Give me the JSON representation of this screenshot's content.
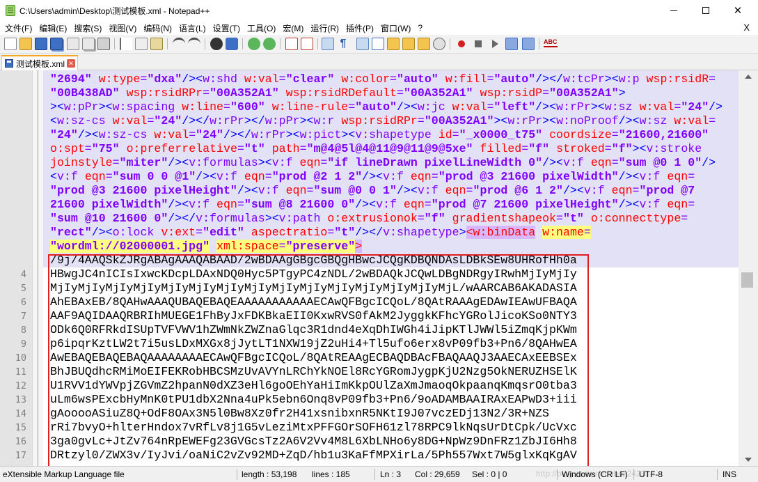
{
  "window": {
    "title": "C:\\Users\\admin\\Desktop\\测试模板.xml - Notepad++"
  },
  "menu": [
    "文件(F)",
    "编辑(E)",
    "搜索(S)",
    "视图(V)",
    "编码(N)",
    "语言(L)",
    "设置(T)",
    "工具(O)",
    "宏(M)",
    "运行(R)",
    "插件(P)",
    "窗口(W)",
    "?"
  ],
  "menu_close": "X",
  "tab": {
    "label": "测试模板.xml"
  },
  "toolbar": {
    "spellcheck_label": "ABC"
  },
  "editor": {
    "line_numbers": [
      "4",
      "5",
      "6",
      "7",
      "8",
      "9",
      "10",
      "11",
      "12",
      "13",
      "14",
      "15",
      "16",
      "17"
    ],
    "wrapped_lines": [
      [
        {
          "c": "v",
          "t": "\"2694\""
        },
        {
          "c": "t",
          "t": " "
        },
        {
          "c": "a",
          "t": "w:type"
        },
        {
          "c": "t",
          "t": "="
        },
        {
          "c": "v",
          "t": "\"dxa\""
        },
        {
          "c": "sep",
          "t": "/><"
        },
        {
          "c": "t",
          "t": "w:shd "
        },
        {
          "c": "a",
          "t": "w:val"
        },
        {
          "c": "t",
          "t": "="
        },
        {
          "c": "v",
          "t": "\"clear\""
        },
        {
          "c": "t",
          "t": " "
        },
        {
          "c": "a",
          "t": "w:color"
        },
        {
          "c": "t",
          "t": "="
        },
        {
          "c": "v",
          "t": "\"auto\""
        },
        {
          "c": "t",
          "t": " "
        },
        {
          "c": "a",
          "t": "w:fill"
        },
        {
          "c": "t",
          "t": "="
        },
        {
          "c": "v",
          "t": "\"auto\""
        },
        {
          "c": "sep",
          "t": "/></"
        },
        {
          "c": "t",
          "t": "w:tcPr"
        },
        {
          "c": "sep",
          "t": "><"
        },
        {
          "c": "t",
          "t": "w:p "
        },
        {
          "c": "a",
          "t": "wsp:rsidR"
        },
        {
          "c": "t",
          "t": "="
        }
      ],
      [
        {
          "c": "v",
          "t": "\"00B438AD\""
        },
        {
          "c": "t",
          "t": " "
        },
        {
          "c": "a",
          "t": "wsp:rsidRPr"
        },
        {
          "c": "t",
          "t": "="
        },
        {
          "c": "v",
          "t": "\"00A352A1\""
        },
        {
          "c": "t",
          "t": " "
        },
        {
          "c": "a",
          "t": "wsp:rsidRDefault"
        },
        {
          "c": "t",
          "t": "="
        },
        {
          "c": "v",
          "t": "\"00A352A1\""
        },
        {
          "c": "t",
          "t": " "
        },
        {
          "c": "a",
          "t": "wsp:rsidP"
        },
        {
          "c": "t",
          "t": "="
        },
        {
          "c": "v",
          "t": "\"00A352A1\""
        },
        {
          "c": "sep",
          "t": ">"
        }
      ],
      [
        {
          "c": "sep",
          "t": "><"
        },
        {
          "c": "t",
          "t": "w:pPr"
        },
        {
          "c": "sep",
          "t": "><"
        },
        {
          "c": "t",
          "t": "w:spacing "
        },
        {
          "c": "a",
          "t": "w:line"
        },
        {
          "c": "t",
          "t": "="
        },
        {
          "c": "v",
          "t": "\"600\""
        },
        {
          "c": "t",
          "t": " "
        },
        {
          "c": "a",
          "t": "w:line-rule"
        },
        {
          "c": "t",
          "t": "="
        },
        {
          "c": "v",
          "t": "\"auto\""
        },
        {
          "c": "sep",
          "t": "/><"
        },
        {
          "c": "t",
          "t": "w:jc "
        },
        {
          "c": "a",
          "t": "w:val"
        },
        {
          "c": "t",
          "t": "="
        },
        {
          "c": "v",
          "t": "\"left\""
        },
        {
          "c": "sep",
          "t": "/><"
        },
        {
          "c": "t",
          "t": "w:rPr"
        },
        {
          "c": "sep",
          "t": "><"
        },
        {
          "c": "t",
          "t": "w:sz "
        },
        {
          "c": "a",
          "t": "w:val"
        },
        {
          "c": "t",
          "t": "="
        },
        {
          "c": "v",
          "t": "\"24\""
        },
        {
          "c": "sep",
          "t": "/>"
        }
      ],
      [
        {
          "c": "sep",
          "t": "<"
        },
        {
          "c": "t",
          "t": "w:sz-cs "
        },
        {
          "c": "a",
          "t": "w:val"
        },
        {
          "c": "t",
          "t": "="
        },
        {
          "c": "v",
          "t": "\"24\""
        },
        {
          "c": "sep",
          "t": "/></"
        },
        {
          "c": "t",
          "t": "w:rPr"
        },
        {
          "c": "sep",
          "t": "></"
        },
        {
          "c": "t",
          "t": "w:pPr"
        },
        {
          "c": "sep",
          "t": "><"
        },
        {
          "c": "t",
          "t": "w:r "
        },
        {
          "c": "a",
          "t": "wsp:rsidRPr"
        },
        {
          "c": "t",
          "t": "="
        },
        {
          "c": "v",
          "t": "\"00A352A1\""
        },
        {
          "c": "sep",
          "t": "><"
        },
        {
          "c": "t",
          "t": "w:rPr"
        },
        {
          "c": "sep",
          "t": "><"
        },
        {
          "c": "t",
          "t": "w:noProof"
        },
        {
          "c": "sep",
          "t": "/><"
        },
        {
          "c": "t",
          "t": "w:sz "
        },
        {
          "c": "a",
          "t": "w:val"
        },
        {
          "c": "t",
          "t": "="
        }
      ],
      [
        {
          "c": "v",
          "t": "\"24\""
        },
        {
          "c": "sep",
          "t": "/><"
        },
        {
          "c": "t",
          "t": "w:sz-cs "
        },
        {
          "c": "a",
          "t": "w:val"
        },
        {
          "c": "t",
          "t": "="
        },
        {
          "c": "v",
          "t": "\"24\""
        },
        {
          "c": "sep",
          "t": "/></"
        },
        {
          "c": "t",
          "t": "w:rPr"
        },
        {
          "c": "sep",
          "t": "><"
        },
        {
          "c": "t",
          "t": "w:pict"
        },
        {
          "c": "sep",
          "t": "><"
        },
        {
          "c": "t",
          "t": "v:shapetype "
        },
        {
          "c": "a",
          "t": "id"
        },
        {
          "c": "t",
          "t": "="
        },
        {
          "c": "v",
          "t": "\"_x0000_t75\""
        },
        {
          "c": "t",
          "t": " "
        },
        {
          "c": "a",
          "t": "coordsize"
        },
        {
          "c": "t",
          "t": "="
        },
        {
          "c": "v",
          "t": "\"21600,21600\""
        }
      ],
      [
        {
          "c": "a",
          "t": "o:spt"
        },
        {
          "c": "t",
          "t": "="
        },
        {
          "c": "v",
          "t": "\"75\""
        },
        {
          "c": "t",
          "t": " "
        },
        {
          "c": "a",
          "t": "o:preferrelative"
        },
        {
          "c": "t",
          "t": "="
        },
        {
          "c": "v",
          "t": "\"t\""
        },
        {
          "c": "t",
          "t": " "
        },
        {
          "c": "a",
          "t": "path"
        },
        {
          "c": "t",
          "t": "="
        },
        {
          "c": "v",
          "t": "\"m@4@5l@4@11@9@11@9@5xe\""
        },
        {
          "c": "t",
          "t": " "
        },
        {
          "c": "a",
          "t": "filled"
        },
        {
          "c": "t",
          "t": "="
        },
        {
          "c": "v",
          "t": "\"f\""
        },
        {
          "c": "t",
          "t": " "
        },
        {
          "c": "a",
          "t": "stroked"
        },
        {
          "c": "t",
          "t": "="
        },
        {
          "c": "v",
          "t": "\"f\""
        },
        {
          "c": "sep",
          "t": "><"
        },
        {
          "c": "t",
          "t": "v:stroke"
        }
      ],
      [
        {
          "c": "a",
          "t": "joinstyle"
        },
        {
          "c": "t",
          "t": "="
        },
        {
          "c": "v",
          "t": "\"miter\""
        },
        {
          "c": "sep",
          "t": "/><"
        },
        {
          "c": "t",
          "t": "v:formulas"
        },
        {
          "c": "sep",
          "t": "><"
        },
        {
          "c": "t",
          "t": "v:f "
        },
        {
          "c": "a",
          "t": "eqn"
        },
        {
          "c": "t",
          "t": "="
        },
        {
          "c": "v",
          "t": "\"if lineDrawn pixelLineWidth 0\""
        },
        {
          "c": "sep",
          "t": "/><"
        },
        {
          "c": "t",
          "t": "v:f "
        },
        {
          "c": "a",
          "t": "eqn"
        },
        {
          "c": "t",
          "t": "="
        },
        {
          "c": "v",
          "t": "\"sum @0 1 0\""
        },
        {
          "c": "sep",
          "t": "/>"
        }
      ],
      [
        {
          "c": "sep",
          "t": "<"
        },
        {
          "c": "t",
          "t": "v:f "
        },
        {
          "c": "a",
          "t": "eqn"
        },
        {
          "c": "t",
          "t": "="
        },
        {
          "c": "v",
          "t": "\"sum 0 0 @1\""
        },
        {
          "c": "sep",
          "t": "/><"
        },
        {
          "c": "t",
          "t": "v:f "
        },
        {
          "c": "a",
          "t": "eqn"
        },
        {
          "c": "t",
          "t": "="
        },
        {
          "c": "v",
          "t": "\"prod @2 1 2\""
        },
        {
          "c": "sep",
          "t": "/><"
        },
        {
          "c": "t",
          "t": "v:f "
        },
        {
          "c": "a",
          "t": "eqn"
        },
        {
          "c": "t",
          "t": "="
        },
        {
          "c": "v",
          "t": "\"prod @3 21600 pixelWidth\""
        },
        {
          "c": "sep",
          "t": "/><"
        },
        {
          "c": "t",
          "t": "v:f "
        },
        {
          "c": "a",
          "t": "eqn"
        },
        {
          "c": "t",
          "t": "="
        }
      ],
      [
        {
          "c": "v",
          "t": "\"prod @3 21600 pixelHeight\""
        },
        {
          "c": "sep",
          "t": "/><"
        },
        {
          "c": "t",
          "t": "v:f "
        },
        {
          "c": "a",
          "t": "eqn"
        },
        {
          "c": "t",
          "t": "="
        },
        {
          "c": "v",
          "t": "\"sum @0 0 1\""
        },
        {
          "c": "sep",
          "t": "/><"
        },
        {
          "c": "t",
          "t": "v:f "
        },
        {
          "c": "a",
          "t": "eqn"
        },
        {
          "c": "t",
          "t": "="
        },
        {
          "c": "v",
          "t": "\"prod @6 1 2\""
        },
        {
          "c": "sep",
          "t": "/><"
        },
        {
          "c": "t",
          "t": "v:f "
        },
        {
          "c": "a",
          "t": "eqn"
        },
        {
          "c": "t",
          "t": "="
        },
        {
          "c": "v",
          "t": "\"prod @7"
        }
      ],
      [
        {
          "c": "v",
          "t": "21600 pixelWidth\""
        },
        {
          "c": "sep",
          "t": "/><"
        },
        {
          "c": "t",
          "t": "v:f "
        },
        {
          "c": "a",
          "t": "eqn"
        },
        {
          "c": "t",
          "t": "="
        },
        {
          "c": "v",
          "t": "\"sum @8 21600 0\""
        },
        {
          "c": "sep",
          "t": "/><"
        },
        {
          "c": "t",
          "t": "v:f "
        },
        {
          "c": "a",
          "t": "eqn"
        },
        {
          "c": "t",
          "t": "="
        },
        {
          "c": "v",
          "t": "\"prod @7 21600 pixelHeight\""
        },
        {
          "c": "sep",
          "t": "/><"
        },
        {
          "c": "t",
          "t": "v:f "
        },
        {
          "c": "a",
          "t": "eqn"
        },
        {
          "c": "t",
          "t": "="
        }
      ],
      [
        {
          "c": "v",
          "t": "\"sum @10 21600 0\""
        },
        {
          "c": "sep",
          "t": "/></"
        },
        {
          "c": "t",
          "t": "v:formulas"
        },
        {
          "c": "sep",
          "t": "><"
        },
        {
          "c": "t",
          "t": "v:path "
        },
        {
          "c": "a",
          "t": "o:extrusionok"
        },
        {
          "c": "t",
          "t": "="
        },
        {
          "c": "v",
          "t": "\"f\""
        },
        {
          "c": "t",
          "t": " "
        },
        {
          "c": "a",
          "t": "gradientshapeok"
        },
        {
          "c": "t",
          "t": "="
        },
        {
          "c": "v",
          "t": "\"t\""
        },
        {
          "c": "t",
          "t": " "
        },
        {
          "c": "a",
          "t": "o:connecttype"
        },
        {
          "c": "t",
          "t": "="
        }
      ],
      [
        {
          "c": "v",
          "t": "\"rect\""
        },
        {
          "c": "sep",
          "t": "/><"
        },
        {
          "c": "t",
          "t": "o:lock "
        },
        {
          "c": "a",
          "t": "v:ext"
        },
        {
          "c": "t",
          "t": "="
        },
        {
          "c": "v",
          "t": "\"edit\""
        },
        {
          "c": "t",
          "t": " "
        },
        {
          "c": "a",
          "t": "aspectratio"
        },
        {
          "c": "t",
          "t": "="
        },
        {
          "c": "v",
          "t": "\"t\""
        },
        {
          "c": "sep",
          "t": "/></"
        },
        {
          "c": "t",
          "t": "v:shapetype"
        },
        {
          "c": "sep",
          "t": ">"
        },
        {
          "c": "hl",
          "t": "<w:binData"
        },
        {
          "c": "t",
          "t": " "
        },
        {
          "c": "a hl2",
          "t": "w:name"
        },
        {
          "c": "t hl2",
          "t": "="
        }
      ],
      [
        {
          "c": "v hl2",
          "t": "\"wordml://02000001.jpg\""
        },
        {
          "c": "t",
          "t": " "
        },
        {
          "c": "a hl2",
          "t": "xml:space"
        },
        {
          "c": "t hl2",
          "t": "="
        },
        {
          "c": "v hl2",
          "t": "\"preserve\""
        },
        {
          "c": "hl",
          "t": ">"
        }
      ],
      [
        {
          "c": "bin",
          "t": "/9j/4AAQSkZJRgABAgAAAQABAAD/2wBDAAgGBgcGBQgHBwcJCQgKDBQNDAsLDBkSEw8UHRofHh0a"
        }
      ]
    ],
    "base64_lines": [
      "HBwgJC4nICIsIxwcKDcpLDAxNDQ0Hyc5PTgyPC4zNDL/2wBDAQkJCQwLDBgNDRgyIRwhMjIyMjIy",
      "MjIyMjIyMjIyMjIyMjIyMjIyMjIyMjIyMjIyMjIyMjIyMjIyMjIyMjIyMjL/wAARCAB6AKADASIA",
      "AhEBAxEB/8QAHwAAAQUBAQEBAQEAAAAAAAAAAAECAwQFBgcICQoL/8QAtRAAAgEDAwIEAwUFBAQA",
      "AAF9AQIDAAQRBRIhMUEGE1FhByJxFDKBkaEII0KxwRVS0fAkM2JyggkKFhcYGRolJicoKSo0NTY3",
      "ODk6Q0RFRkdISUpTVFVWV1hZWmNkZWZnaGlqc3R1dnd4eXqDhIWGh4iJipKTlJWWl5iZmqKjpKWm",
      "p6ipqrKztLW2t7i5usLDxMXGx8jJytLT1NXW19jZ2uHi4+Tl5ufo6erx8vP09fb3+Pn6/8QAHwEA",
      "AwEBAQEBAQEBAQAAAAAAAAECAwQFBgcICQoL/8QAtREAAgECBAQDBAcFBAQAAQJ3AAECAxEEBSEx",
      "BhJBUQdhcRMiMoEIFEKRobHBCSMzUvAVYnLRChYkNOEl8RcYGRomJygpKjU2Nzg5OkNERUZHSElK",
      "U1RVV1dYWVpjZGVmZ2hpanN0dXZ3eHl6goOEhYaHiImKkpOUlZaXmJmaoqOkpaanqKmqsrO0tba3",
      "uLm6wsPExcbHyMnK0tPU1dbX2Nna4uPk5ebn6Onq8vP09fb3+Pn6/9oADAMBAAIRAxEAPwD3+iii",
      "gAooooASiuZ8Q+OdF8OAx3N5l0Bw8Xz0fr2H41xsnibxnR5NKtI9J07vczEDj13N2/3R+NZS",
      "rRi7bvyO+hlterHndox7vRfLv8j1G5vLeziMtxPFFGOrSOFH61zl78RPC9lkNqsUrDtCpk/UcVxc",
      "3ga0gvLc+JtZv764nRpEWEFg23GVGcsTz2A6V2Vv4M8L6XbLNHo6y8DG+NpWz9DnFRz1ZbJI6Hh8",
      "DRtzyl0/ZWX3v/IyJvi/oaNiC2vZv92MD+ZqD/hb1u3KaFfMPXirLa/5Ph557Wxt7W5glxKqKgAV"
    ]
  },
  "statusbar": {
    "filetype": "eXtensible Markup Language file",
    "length": "length : 53,198",
    "lines": "lines : 185",
    "ln": "Ln : 3",
    "col": "Col : 29,659",
    "sel": "Sel : 0 | 0",
    "eol": "Windows (CR LF)",
    "encoding": "UTF-8",
    "ins": "INS",
    "watermark": "http://blog.csdn.net/abc2242316"
  }
}
